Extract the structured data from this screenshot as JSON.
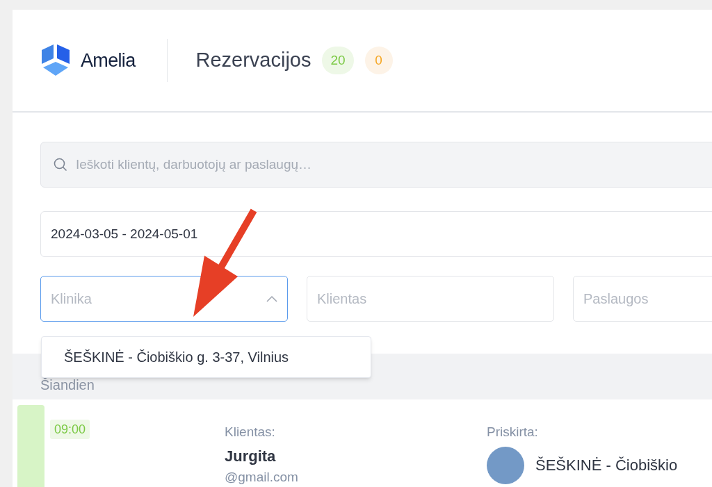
{
  "brand": {
    "name": "Amelia"
  },
  "header": {
    "title": "Rezervacijos",
    "counts": [
      {
        "value": "20",
        "kind": "approved"
      },
      {
        "value": "0",
        "kind": "pending"
      }
    ]
  },
  "search": {
    "placeholder": "Ieškoti klientų, darbuotojų ar paslaugų…"
  },
  "date_range": {
    "value": "2024-03-05 - 2024-05-01"
  },
  "filters": [
    {
      "placeholder": "Klinika",
      "expanded": true
    },
    {
      "placeholder": "Klientas",
      "expanded": false
    },
    {
      "placeholder": "Paslaugos",
      "expanded": false
    }
  ],
  "dropdown_options": [
    "ŠEŠKINĖ - Čiobiškio g. 3-37, Vilnius"
  ],
  "day": {
    "label": "Šiandien"
  },
  "appointments": [
    {
      "time": "09:00",
      "customer_label": "Klientas:",
      "customer_name": "Jurgita",
      "customer_email": "@gmail.com",
      "assigned_label": "Priskirta:",
      "assigned": "ŠEŠKINĖ - Čiobiškio"
    }
  ]
}
